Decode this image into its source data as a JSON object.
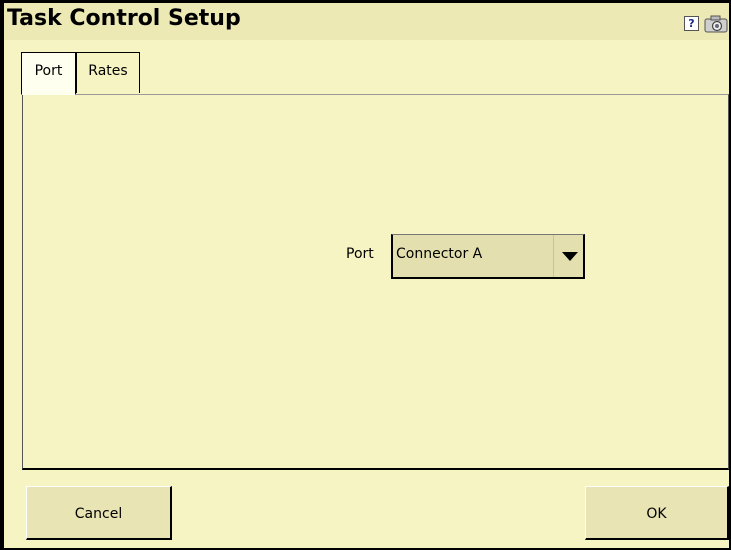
{
  "window": {
    "title": "Task Control Setup"
  },
  "header": {
    "help_icon_glyph": "?"
  },
  "tabs": [
    {
      "label": "Port",
      "active": true
    },
    {
      "label": "Rates",
      "active": false
    }
  ],
  "port": {
    "label": "Port",
    "selected": "Connector A"
  },
  "buttons": {
    "cancel": "Cancel",
    "ok": "OK"
  },
  "icons": {
    "help": "help-icon",
    "camera": "camera-icon",
    "dropdown": "chevron-down-icon"
  }
}
